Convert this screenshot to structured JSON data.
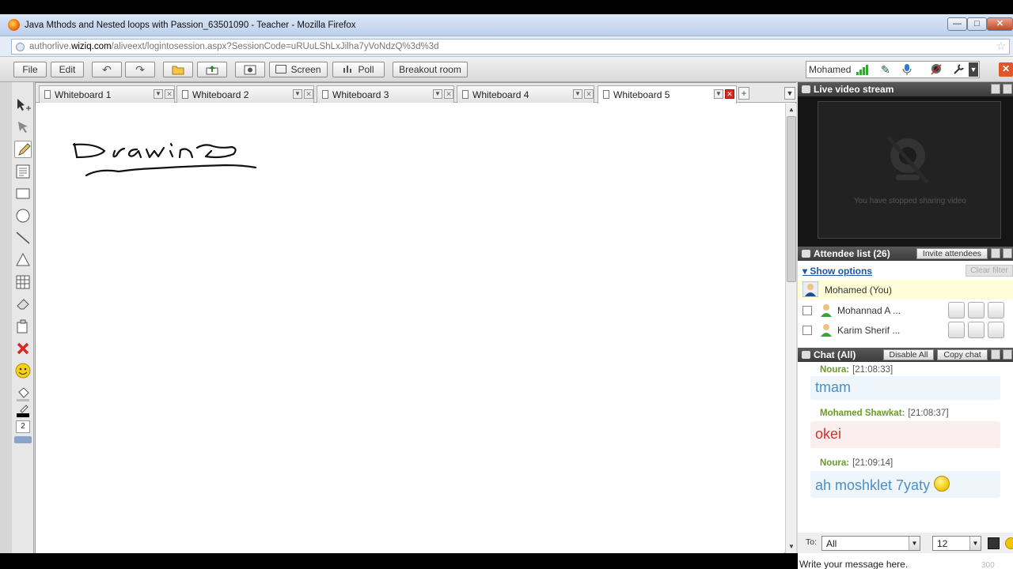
{
  "window": {
    "title": "Java Mthods and Nested loops with Passion_63501090 - Teacher - Mozilla Firefox",
    "min_glyph": "—",
    "max_glyph": "□",
    "close_glyph": "✕"
  },
  "address": {
    "prefix": "authorlive.",
    "domain": "wiziq.com",
    "path": "/aliveext/logintosession.aspx?SessionCode=uRUuLShLxJilha7yVoNdzQ%3d%3d",
    "star_glyph": "☆"
  },
  "toolbar": {
    "file_label": "File",
    "edit_label": "Edit",
    "undo_glyph": "↶",
    "redo_glyph": "↷",
    "screen_label": "Screen",
    "poll_label": "Poll",
    "breakout_label": "Breakout room",
    "user_name": "Mohamed",
    "close_glyph": "✕",
    "dropdown_glyph": "▼"
  },
  "whiteboard": {
    "tabs": [
      {
        "label": "Whiteboard 1"
      },
      {
        "label": "Whiteboard 2"
      },
      {
        "label": "Whiteboard 3"
      },
      {
        "label": "Whiteboard 4"
      },
      {
        "label": "Whiteboard 5"
      }
    ],
    "add_tab_glyph": "+",
    "more_glyph": "▼",
    "dropdown_glyph": "▼",
    "close_glyph": "✕",
    "pen_size": "2",
    "scroll_up_glyph": "▲",
    "scroll_down_glyph": "▼"
  },
  "video": {
    "title": "Live video stream",
    "status": "You have stopped sharing video"
  },
  "attendees": {
    "title": "Attendee list (26)",
    "invite_label": "Invite attendees",
    "show_options_label": "▾ Show options",
    "clear_filter_label": "Clear filter",
    "rows": [
      {
        "name": "Mohamed (You)"
      },
      {
        "name": "Mohannad A  ..."
      },
      {
        "name": "Karim Sherif ..."
      }
    ]
  },
  "chat": {
    "title": "Chat (All)",
    "disable_all_label": "Disable All",
    "copy_chat_label": "Copy chat",
    "messages": [
      {
        "sender": "Noura:",
        "time": "[21:08:33]",
        "text": "tmam",
        "color": "#4a90c8"
      },
      {
        "sender": "Mohamed Shawkat:",
        "time": "[21:08:37]",
        "text": "okei",
        "color": "#d23030"
      },
      {
        "sender": "Noura:",
        "time": "[21:09:14]",
        "text": "ah moshklet 7yaty",
        "color": "#4a90c8"
      }
    ],
    "to_label": "To:",
    "to_value": "All",
    "font_size": "12",
    "input_placeholder": "Write your message here.",
    "char_limit": "300",
    "dropdown_glyph": "▼"
  },
  "colors": {
    "accent_green": "#3aa23a",
    "chat_sender_green": "#6a9a2b",
    "close_red": "#d9281f"
  }
}
